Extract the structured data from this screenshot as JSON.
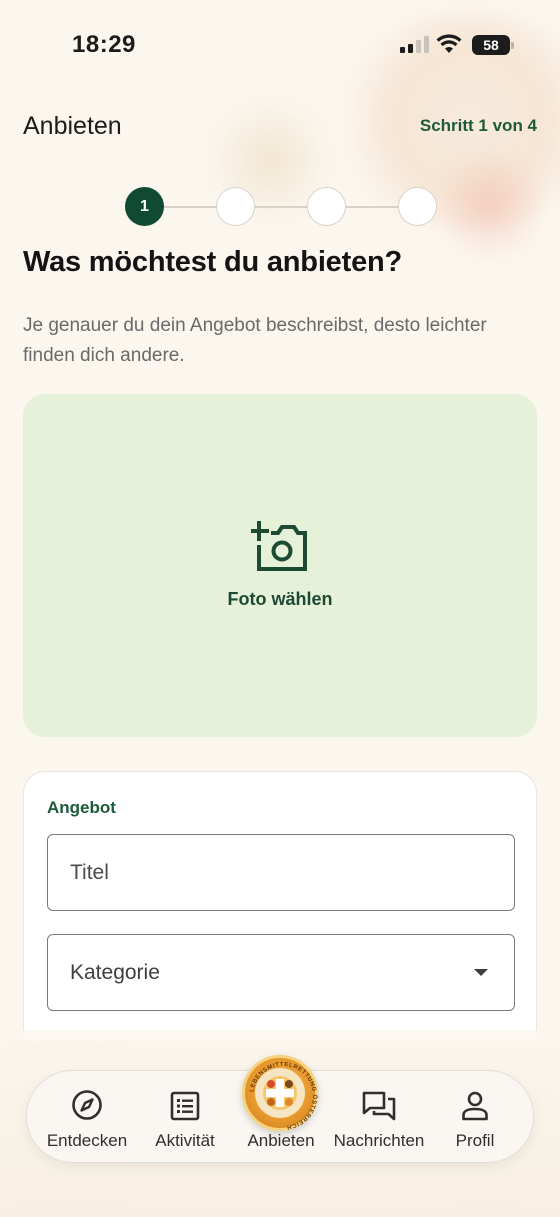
{
  "status_bar": {
    "time": "18:29",
    "battery": "58"
  },
  "header": {
    "title": "Anbieten",
    "step_label": "Schritt 1 von 4"
  },
  "stepper": {
    "current": 1,
    "total": 4,
    "active_label": "1"
  },
  "intro": {
    "heading": "Was möchtest du anbieten?",
    "subtext": "Je genauer du dein Angebot beschreibst, desto leichter finden dich andere."
  },
  "photo": {
    "label": "Foto wählen",
    "icon": "add-camera-icon"
  },
  "form": {
    "section_label": "Angebot",
    "title_placeholder": "Titel",
    "category_placeholder": "Kategorie"
  },
  "tab_bar": {
    "items": [
      {
        "label": "Entdecken",
        "icon": "compass-icon"
      },
      {
        "label": "Aktivität",
        "icon": "list-icon"
      },
      {
        "label": "Anbieten",
        "icon": "logo-badge"
      },
      {
        "label": "Nachrichten",
        "icon": "chat-icon"
      },
      {
        "label": "Profil",
        "icon": "person-icon"
      }
    ],
    "badge_text": "LEBENSMITTELRETTUNG ÖSTERREICH"
  },
  "colors": {
    "accent": "#114a32",
    "accent_text": "#1d5a3a",
    "photo_bg": "#e5f1d8",
    "background": "#fbf6ee"
  }
}
